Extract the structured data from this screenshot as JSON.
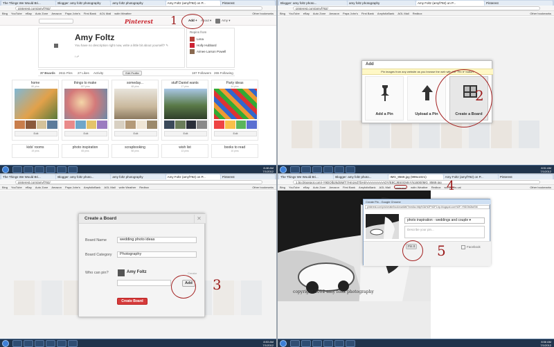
{
  "browser": {
    "tabs": [
      [
        "The Things We Would Bri...",
        "Blogger: amy foltz photography",
        "amy foltz photography",
        "Amy Foltz (amyf792) on P...",
        "Pinterest"
      ],
      [
        "Blogger: amy foltz photo...",
        "amy foltz photography",
        "Amy Foltz (amyf792) on P...",
        "Pinterest"
      ],
      [
        "The Things We Would Bri...",
        "Blogger: amy foltz photo...",
        "amy foltz photography",
        "Amy Foltz (amyf792) on P...",
        "Pinterest"
      ],
      [
        "The Things We Would Bri...",
        "Blogger: amy foltz photo...",
        "IMG_8569.jpg (999x1021)",
        "Amy Foltz (amyf792) on P...",
        "Pinterest"
      ]
    ],
    "urls": [
      "pinterest.com/amyf792/",
      "pinterest.com/amyf792/",
      "pinterest.com/amyf792/",
      "1.bp.blogspot.com/-Y9DOlb2kdSM/T7HmzeZTbHi/AAAAAAAAAOY/E8CJ8S0GMnY/s1600/IMG_8569.jpg"
    ],
    "bookmarks": [
      "Bing",
      "YouTube",
      "eBay",
      "Auto Zone",
      "Amazon",
      "Papa John's",
      "First Bank",
      "AmyfoltzBank",
      "AOL Mail",
      "pinterest",
      "wdtn Weather",
      "Redbox",
      "scc points cal",
      "scc points allowance"
    ],
    "other_bookmarks": "Other bookmarks"
  },
  "taskbar": {
    "times": [
      "8:48 AM",
      "8:51 AM",
      "8:53 AM",
      "8:56 AM"
    ],
    "dates": [
      "7/1/2012",
      "7/1/2012",
      "7/1/2012",
      "7/1/2012"
    ]
  },
  "pinterest": {
    "logo": "Pinterest",
    "nav": {
      "add": "Add +",
      "about": "About ▾",
      "user": "Amy ▾"
    },
    "profile": {
      "name": "Amy Foltz",
      "description": "You have no description right now, write a little bit about yourself? ✎",
      "repins_header": "Repins from",
      "repins_from": [
        "Lena",
        "Holly Hubbard",
        "Aimee Larson Powell"
      ]
    },
    "stats": {
      "boards": "37 Boards",
      "pins": "2611 Pins",
      "likes": "27 Likes",
      "activity": "Activity",
      "edit_profile": "Edit Profile",
      "followers": "187 Followers",
      "following": "265 Following"
    },
    "boards": [
      {
        "title": "home",
        "count": "80 pins",
        "edit": "Edit"
      },
      {
        "title": "things to make",
        "count": "157 pins",
        "edit": "Edit"
      },
      {
        "title": "someday...",
        "count": "48 pins",
        "edit": "Edit"
      },
      {
        "title": "stuff Daniel wants",
        "count": "17 pins",
        "edit": "Edit"
      },
      {
        "title": "Party ideas",
        "count": "44 pins",
        "edit": "Edit"
      }
    ],
    "boards_row2": [
      {
        "title": "kids' rooms",
        "count": "19 pins"
      },
      {
        "title": "photo inspiration",
        "count": "65 pins"
      },
      {
        "title": "scrapbooking",
        "count": "58 pins"
      },
      {
        "title": "wish list",
        "count": "13 pins"
      },
      {
        "title": "books to read",
        "count": "10 pins"
      }
    ]
  },
  "add_modal": {
    "title": "Add",
    "strip": "Pin images from any website as you browse the web with the \"Pin It\" button.",
    "options": [
      "Add a Pin",
      "Upload a Pin",
      "Create a Board"
    ]
  },
  "create_modal": {
    "title": "Create a Board",
    "board_name_label": "Board Name",
    "board_name_value": "wedding photo ideas",
    "category_label": "Board Category",
    "category_value": "Photography",
    "who_label": "Who can pin?",
    "owner": "Amy Foltz",
    "creator": "Creator",
    "add_button": "Add",
    "create_button": "Create Board"
  },
  "pin_popup": {
    "title": "Create Pin - Google Chrome",
    "url": "pinterest.com/pin/create/bookmarklet/?media=http%3A%2F%2F1.bp.blogspot.com%2F-Y9DOlb2kdSM",
    "board_select": "photo inspiration - weddings and couple ▾",
    "desc_placeholder": "Describe your pin...",
    "pin_button": "Pin It",
    "facebook": "Facebook"
  },
  "photo": {
    "watermark": "copyright 2012 amy foltz photography"
  },
  "steps": [
    "1",
    "2",
    "3",
    "4",
    "5"
  ],
  "colors": {
    "pinterest_red": "#c8232c",
    "annotation": "#9b1b1b",
    "taskbar": "#20344c"
  }
}
